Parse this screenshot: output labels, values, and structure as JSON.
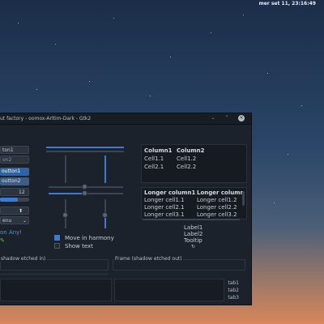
{
  "top_bar": {
    "clock": "mer set 11, 23:16:49"
  },
  "window": {
    "title": "ut factory - oomox-Arltim-Dark - Gtk2",
    "controls": {
      "minimize": "⌄",
      "maximize": "⌃",
      "close": "×"
    }
  },
  "buttons": {
    "button1": "ton1",
    "button2": "on2",
    "selected1": "outton1",
    "selected2": "outton2",
    "spin_value": "12",
    "menu": "enu",
    "link": "on Any!"
  },
  "checkboxes": {
    "harmony": {
      "label": "Move in harmony",
      "checked": true
    },
    "show_text": {
      "label": "Show text",
      "checked": false
    }
  },
  "table1": {
    "headers": [
      "Column1",
      "Column2"
    ],
    "rows": [
      [
        "Cell1.1",
        "Cell1.2"
      ],
      [
        "Cell2.1",
        "Cell2.2"
      ]
    ]
  },
  "table2": {
    "headers": [
      "Longer column1",
      "Longer column"
    ],
    "rows": [
      [
        "Longer cell1.1",
        "Longer cell1.2"
      ],
      [
        "Longer cell2.1",
        "Longer cell2.2"
      ],
      [
        "Longer cell3.1",
        "Longer cell3.2"
      ]
    ]
  },
  "labels": {
    "label1": "Label1",
    "label2": "Label2",
    "tooltip": "Tooltip"
  },
  "frames": {
    "frame_in": "shadow etched in)",
    "frame_out": "Frame (shadow etched out)"
  },
  "tabs": [
    "tab1",
    "tab2",
    "tab3"
  ],
  "progress": {
    "horizontal_fraction": 0.6
  },
  "colors": {
    "accent": "#3d7ad0",
    "window_bg": "#1c222b"
  }
}
